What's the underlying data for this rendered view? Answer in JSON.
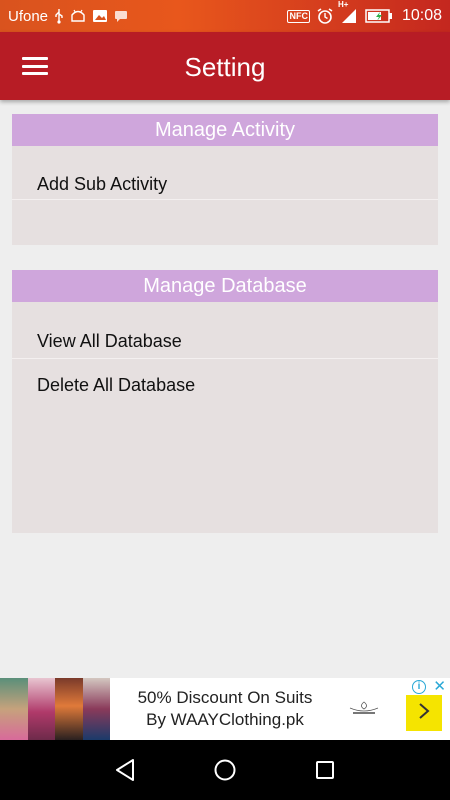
{
  "status_bar": {
    "carrier": "Ufone",
    "nfc_label": "NFC",
    "network_label": "H+",
    "time": "10:08",
    "icons": [
      "usb-icon",
      "android-debug-icon",
      "image-notification-icon",
      "message-icon",
      "nfc-icon",
      "alarm-icon",
      "signal-icon",
      "battery-charging-icon"
    ]
  },
  "app_bar": {
    "title": "Setting",
    "menu_icon": "hamburger-menu-icon"
  },
  "sections": [
    {
      "header": "Manage Activity",
      "items": [
        "Add Sub Activity"
      ]
    },
    {
      "header": "Manage Database",
      "items": [
        "View All Database",
        "Delete All Database"
      ]
    }
  ],
  "ad": {
    "line1": "50% Discount On Suits",
    "line2": "By WAAYClothing.pk",
    "info_icon": "info-icon",
    "close_icon": "close-icon",
    "cta_icon": "chevron-right-icon"
  },
  "nav_bar": {
    "icons": [
      "back-icon",
      "home-icon",
      "recents-icon"
    ]
  },
  "colors": {
    "app_bar": "#b71c25",
    "section_header": "#cfa6dc",
    "card_background": "#e6e0e0",
    "page_background": "#eeeeee",
    "ad_cta": "#f5e400"
  }
}
